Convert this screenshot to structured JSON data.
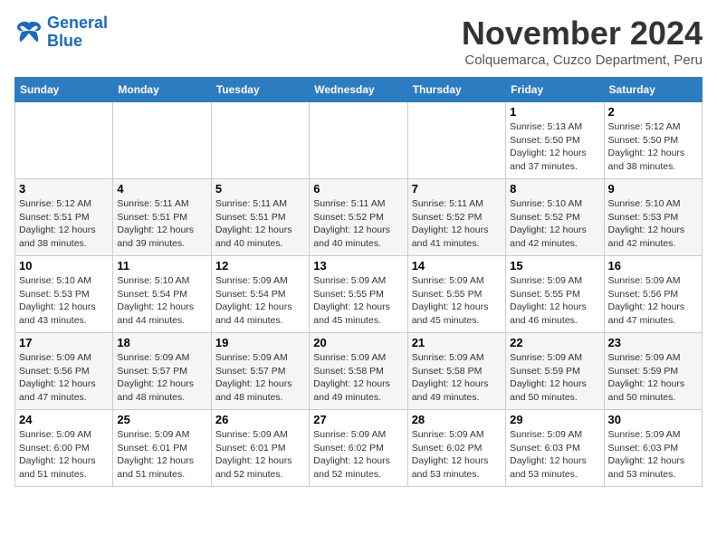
{
  "logo": {
    "line1": "General",
    "line2": "Blue"
  },
  "title": "November 2024",
  "subtitle": "Colquemarca, Cuzco Department, Peru",
  "weekdays": [
    "Sunday",
    "Monday",
    "Tuesday",
    "Wednesday",
    "Thursday",
    "Friday",
    "Saturday"
  ],
  "weeks": [
    [
      {
        "day": "",
        "info": ""
      },
      {
        "day": "",
        "info": ""
      },
      {
        "day": "",
        "info": ""
      },
      {
        "day": "",
        "info": ""
      },
      {
        "day": "",
        "info": ""
      },
      {
        "day": "1",
        "info": "Sunrise: 5:13 AM\nSunset: 5:50 PM\nDaylight: 12 hours\nand 37 minutes."
      },
      {
        "day": "2",
        "info": "Sunrise: 5:12 AM\nSunset: 5:50 PM\nDaylight: 12 hours\nand 38 minutes."
      }
    ],
    [
      {
        "day": "3",
        "info": "Sunrise: 5:12 AM\nSunset: 5:51 PM\nDaylight: 12 hours\nand 38 minutes."
      },
      {
        "day": "4",
        "info": "Sunrise: 5:11 AM\nSunset: 5:51 PM\nDaylight: 12 hours\nand 39 minutes."
      },
      {
        "day": "5",
        "info": "Sunrise: 5:11 AM\nSunset: 5:51 PM\nDaylight: 12 hours\nand 40 minutes."
      },
      {
        "day": "6",
        "info": "Sunrise: 5:11 AM\nSunset: 5:52 PM\nDaylight: 12 hours\nand 40 minutes."
      },
      {
        "day": "7",
        "info": "Sunrise: 5:11 AM\nSunset: 5:52 PM\nDaylight: 12 hours\nand 41 minutes."
      },
      {
        "day": "8",
        "info": "Sunrise: 5:10 AM\nSunset: 5:52 PM\nDaylight: 12 hours\nand 42 minutes."
      },
      {
        "day": "9",
        "info": "Sunrise: 5:10 AM\nSunset: 5:53 PM\nDaylight: 12 hours\nand 42 minutes."
      }
    ],
    [
      {
        "day": "10",
        "info": "Sunrise: 5:10 AM\nSunset: 5:53 PM\nDaylight: 12 hours\nand 43 minutes."
      },
      {
        "day": "11",
        "info": "Sunrise: 5:10 AM\nSunset: 5:54 PM\nDaylight: 12 hours\nand 44 minutes."
      },
      {
        "day": "12",
        "info": "Sunrise: 5:09 AM\nSunset: 5:54 PM\nDaylight: 12 hours\nand 44 minutes."
      },
      {
        "day": "13",
        "info": "Sunrise: 5:09 AM\nSunset: 5:55 PM\nDaylight: 12 hours\nand 45 minutes."
      },
      {
        "day": "14",
        "info": "Sunrise: 5:09 AM\nSunset: 5:55 PM\nDaylight: 12 hours\nand 45 minutes."
      },
      {
        "day": "15",
        "info": "Sunrise: 5:09 AM\nSunset: 5:55 PM\nDaylight: 12 hours\nand 46 minutes."
      },
      {
        "day": "16",
        "info": "Sunrise: 5:09 AM\nSunset: 5:56 PM\nDaylight: 12 hours\nand 47 minutes."
      }
    ],
    [
      {
        "day": "17",
        "info": "Sunrise: 5:09 AM\nSunset: 5:56 PM\nDaylight: 12 hours\nand 47 minutes."
      },
      {
        "day": "18",
        "info": "Sunrise: 5:09 AM\nSunset: 5:57 PM\nDaylight: 12 hours\nand 48 minutes."
      },
      {
        "day": "19",
        "info": "Sunrise: 5:09 AM\nSunset: 5:57 PM\nDaylight: 12 hours\nand 48 minutes."
      },
      {
        "day": "20",
        "info": "Sunrise: 5:09 AM\nSunset: 5:58 PM\nDaylight: 12 hours\nand 49 minutes."
      },
      {
        "day": "21",
        "info": "Sunrise: 5:09 AM\nSunset: 5:58 PM\nDaylight: 12 hours\nand 49 minutes."
      },
      {
        "day": "22",
        "info": "Sunrise: 5:09 AM\nSunset: 5:59 PM\nDaylight: 12 hours\nand 50 minutes."
      },
      {
        "day": "23",
        "info": "Sunrise: 5:09 AM\nSunset: 5:59 PM\nDaylight: 12 hours\nand 50 minutes."
      }
    ],
    [
      {
        "day": "24",
        "info": "Sunrise: 5:09 AM\nSunset: 6:00 PM\nDaylight: 12 hours\nand 51 minutes."
      },
      {
        "day": "25",
        "info": "Sunrise: 5:09 AM\nSunset: 6:01 PM\nDaylight: 12 hours\nand 51 minutes."
      },
      {
        "day": "26",
        "info": "Sunrise: 5:09 AM\nSunset: 6:01 PM\nDaylight: 12 hours\nand 52 minutes."
      },
      {
        "day": "27",
        "info": "Sunrise: 5:09 AM\nSunset: 6:02 PM\nDaylight: 12 hours\nand 52 minutes."
      },
      {
        "day": "28",
        "info": "Sunrise: 5:09 AM\nSunset: 6:02 PM\nDaylight: 12 hours\nand 53 minutes."
      },
      {
        "day": "29",
        "info": "Sunrise: 5:09 AM\nSunset: 6:03 PM\nDaylight: 12 hours\nand 53 minutes."
      },
      {
        "day": "30",
        "info": "Sunrise: 5:09 AM\nSunset: 6:03 PM\nDaylight: 12 hours\nand 53 minutes."
      }
    ]
  ]
}
